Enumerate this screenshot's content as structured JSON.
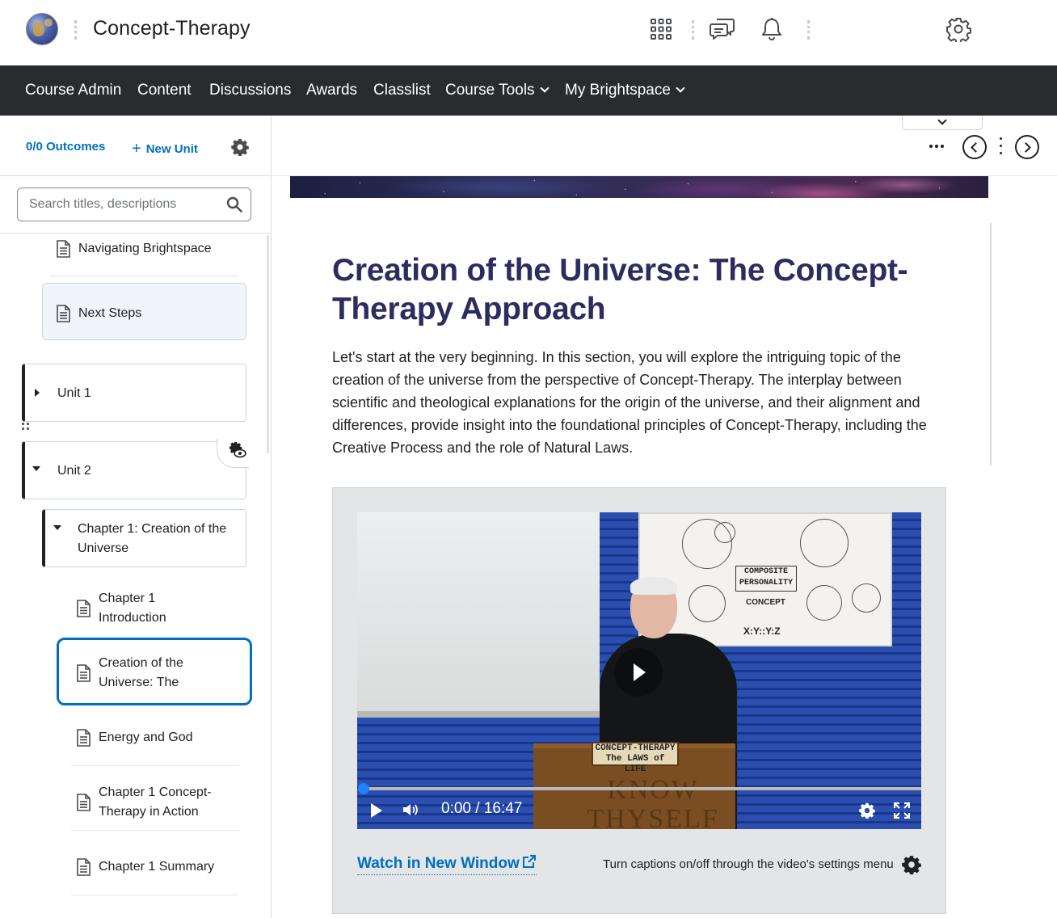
{
  "header": {
    "course_title": "Concept-Therapy",
    "icons": [
      "globe-logo",
      "waffle-grid-icon",
      "chat-bubbles-icon",
      "bell-icon",
      "gear-icon"
    ]
  },
  "nav": {
    "items": [
      {
        "label": "Course Admin"
      },
      {
        "label": "Content"
      },
      {
        "label": "Discussions"
      },
      {
        "label": "Awards"
      },
      {
        "label": "Classlist"
      },
      {
        "label": "Course Tools",
        "dropdown": true
      },
      {
        "label": "My Brightspace",
        "dropdown": true
      }
    ]
  },
  "sidebar": {
    "outcomes_label": "0/0 Outcomes",
    "new_unit_label": "New Unit",
    "search_placeholder": "Search titles, descriptions",
    "items": [
      {
        "label": "Navigating Brightspace",
        "type": "topic"
      },
      {
        "label": "Next Steps",
        "type": "topic"
      },
      {
        "label": "Unit 1",
        "type": "unit",
        "expanded": false
      },
      {
        "label": "Unit 2",
        "type": "unit",
        "expanded": true
      },
      {
        "label": "Chapter 1: Creation of the Universe",
        "type": "chapter",
        "expanded": true
      },
      {
        "label": "Chapter 1 Introduction",
        "type": "topic"
      },
      {
        "label": "Creation of the Universe: The Concept",
        "type": "topic",
        "selected": true
      },
      {
        "label": "Energy and God",
        "type": "topic"
      },
      {
        "label": "Chapter 1 Concept-Therapy in Action",
        "type": "topic"
      },
      {
        "label": "Chapter 1 Summary",
        "type": "topic"
      }
    ]
  },
  "content": {
    "title": "Creation of the Universe: The Concept-Therapy Approach",
    "intro": "Let's start at the very beginning. In this section, you will explore the intriguing topic of the creation of the universe from the perspective of Concept-Therapy. The interplay between scientific and theological explanations for the origin of the universe, and their alignment and differences, provide insight into the foundational principles of Concept-Therapy, including the Creative Process and the role of Natural Laws.",
    "video": {
      "time": "0:00 / 16:47",
      "progress": 0,
      "chart_box": "COMPOSITE PERSONALITY",
      "chart_concept": "CONCEPT",
      "chart_formula": "X:Y::Y:Z",
      "plaque": "CONCEPT-THERAPY The LAWS of LIFE",
      "podium_text": "KNOW THYSELF"
    },
    "watch_link": "Watch in New Window",
    "caption_note": "Turn captions on/off through the video's settings menu"
  },
  "colors": {
    "nav_bg": "#2a2b2e",
    "link": "#006fbf",
    "heading": "#2c2c5e",
    "selected_border": "#006fbf"
  }
}
